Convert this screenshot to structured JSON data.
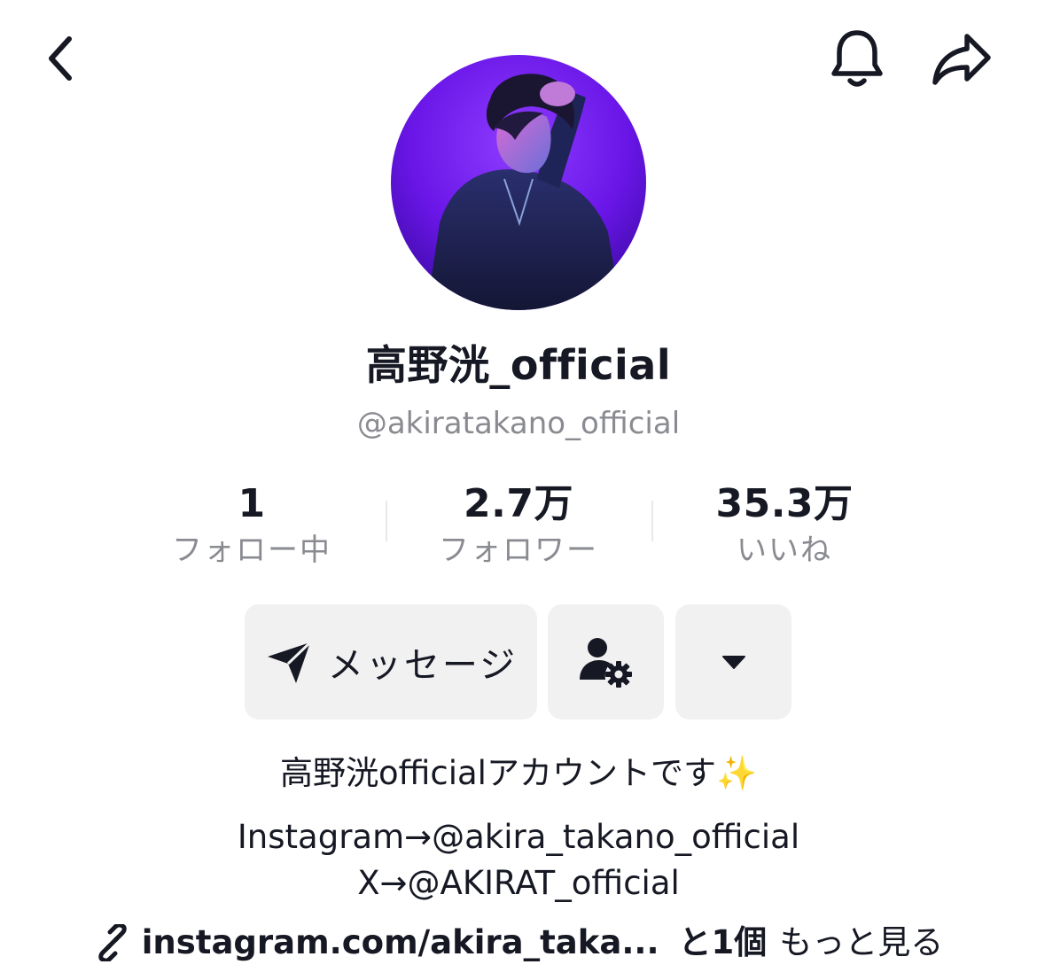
{
  "top_bar": {
    "back_icon": "chevron-left-icon",
    "bell_icon": "bell-icon",
    "share_icon": "share-arrow-icon"
  },
  "profile": {
    "display_name": "高野洸_official",
    "username": "@akiratakano_official",
    "avatar_colors": [
      "#7b1fff",
      "#3a1a8c"
    ]
  },
  "stats": [
    {
      "value": "1",
      "label": "フォロー中"
    },
    {
      "value": "2.7万",
      "label": "フォロワー"
    },
    {
      "value": "35.3万",
      "label": "いいね"
    }
  ],
  "actions": {
    "message_label": "メッセージ",
    "message_icon": "paper-plane-icon",
    "add_friend_icon": "user-gear-icon",
    "more_icon": "caret-down-icon"
  },
  "bio": {
    "line1": "高野洸officialアカウントです✨",
    "line2": "Instagram→@akira_takano_official",
    "line3": "X→@AKIRAT_official"
  },
  "link": {
    "icon": "link-icon",
    "url": "instagram.com/akira_taka...",
    "count": "と1個",
    "see_more": "もっと見る"
  }
}
